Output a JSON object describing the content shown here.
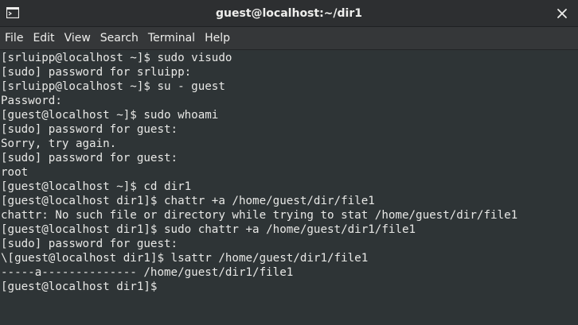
{
  "window": {
    "title": "guest@localhost:~/dir1",
    "icon": "terminal-icon",
    "close_icon": "close-icon"
  },
  "menu": {
    "items": [
      {
        "label": "File"
      },
      {
        "label": "Edit"
      },
      {
        "label": "View"
      },
      {
        "label": "Search"
      },
      {
        "label": "Terminal"
      },
      {
        "label": "Help"
      }
    ]
  },
  "terminal": {
    "lines": [
      "[srluipp@localhost ~]$ sudo visudo",
      "[sudo] password for srluipp:",
      "[srluipp@localhost ~]$ su - guest",
      "Password:",
      "[guest@localhost ~]$ sudo whoami",
      "[sudo] password for guest:",
      "Sorry, try again.",
      "[sudo] password for guest:",
      "root",
      "[guest@localhost ~]$ cd dir1",
      "[guest@localhost dir1]$ chattr +a /home/guest/dir/file1",
      "chattr: No such file or directory while trying to stat /home/guest/dir/file1",
      "[guest@localhost dir1]$ sudo chattr +a /home/guest/dir1/file1",
      "[sudo] password for guest:",
      "\\[guest@localhost dir1]$ lsattr /home/guest/dir1/file1",
      "-----a-------------- /home/guest/dir1/file1",
      "[guest@localhost dir1]$ "
    ]
  },
  "colors": {
    "terminal_bg": "#2e3436",
    "terminal_fg": "#e8e8e6",
    "titlebar_bg": "#2d2f31",
    "menubar_bg": "#353739"
  }
}
